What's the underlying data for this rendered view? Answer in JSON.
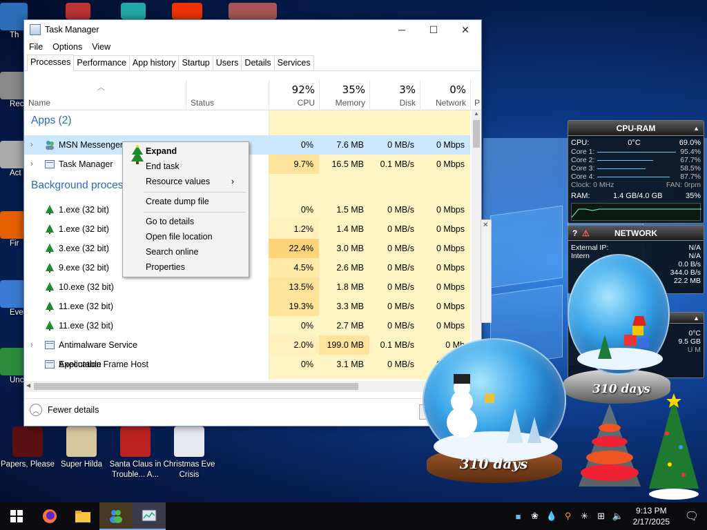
{
  "desktop_icons": [
    {
      "label": "Th",
      "color": "#2a6fb8"
    },
    {
      "label": "Recy",
      "color": "#888"
    },
    {
      "label": "Act",
      "color": "#aaa"
    },
    {
      "label": "Fir",
      "color": "#e66000"
    },
    {
      "label": "Ever",
      "color": "#3a7bd5"
    },
    {
      "label": "Unc",
      "color": "#2d8c3c"
    }
  ],
  "bottom_icons": [
    {
      "label": "Papers, Please",
      "color": "#5a1010"
    },
    {
      "label": "Super Hilda",
      "color": "#d8c8a0"
    },
    {
      "label": "Santa Claus in Trouble... A...",
      "color": "#b22"
    },
    {
      "label": "Christmas Eve Crisis",
      "color": "#e8e8f0"
    }
  ],
  "task_manager": {
    "title": "Task Manager",
    "menu": [
      "File",
      "Options",
      "View"
    ],
    "tabs": [
      "Processes",
      "Performance",
      "App history",
      "Startup",
      "Users",
      "Details",
      "Services"
    ],
    "active_tab": "Processes",
    "columns": {
      "name": "Name",
      "status": "Status",
      "cpu": {
        "pct": "92%",
        "label": "CPU"
      },
      "memory": {
        "pct": "35%",
        "label": "Memory"
      },
      "disk": {
        "pct": "3%",
        "label": "Disk"
      },
      "network": {
        "pct": "0%",
        "label": "Network"
      },
      "power": "P"
    },
    "groups": {
      "apps": "Apps (2)",
      "background": "Background proces"
    },
    "rows": [
      {
        "name": "MSN Messenger",
        "cpu": "0%",
        "mem": "7.6 MB",
        "disk": "0 MB/s",
        "net": "0 Mbps",
        "selected": true,
        "expander": true,
        "icon": "msn-icon"
      },
      {
        "name": "Task Manager",
        "cpu": "9.7%",
        "mem": "16.5 MB",
        "disk": "0.1 MB/s",
        "net": "0 Mbps",
        "expander": true,
        "icon": "taskmgr-icon"
      },
      {
        "name": "1.exe (32 bit)",
        "cpu": "0%",
        "mem": "1.5 MB",
        "disk": "0 MB/s",
        "net": "0 Mbps",
        "icon": "tree-icon"
      },
      {
        "name": "1.exe (32 bit)",
        "cpu": "1.2%",
        "mem": "1.4 MB",
        "disk": "0 MB/s",
        "net": "0 Mbps",
        "icon": "tree-icon"
      },
      {
        "name": "3.exe (32 bit)",
        "cpu": "22.4%",
        "mem": "3.0 MB",
        "disk": "0 MB/s",
        "net": "0 Mbps",
        "icon": "tree-icon"
      },
      {
        "name": "9.exe (32 bit)",
        "cpu": "4.5%",
        "mem": "2.6 MB",
        "disk": "0 MB/s",
        "net": "0 Mbps",
        "icon": "tree-icon"
      },
      {
        "name": "10.exe (32 bit)",
        "cpu": "13.5%",
        "mem": "1.8 MB",
        "disk": "0 MB/s",
        "net": "0 Mbps",
        "icon": "tree-icon"
      },
      {
        "name": "11.exe (32 bit)",
        "cpu": "19.3%",
        "mem": "3.3 MB",
        "disk": "0 MB/s",
        "net": "0 Mbps",
        "icon": "tree-icon"
      },
      {
        "name": "11.exe (32 bit)",
        "cpu": "0%",
        "mem": "2.7 MB",
        "disk": "0 MB/s",
        "net": "0 Mbps",
        "icon": "tree-icon"
      },
      {
        "name": "Antimalware Service Executable",
        "cpu": "2.0%",
        "mem": "199.0 MB",
        "disk": "0.1 MB/s",
        "net": "0 Mb",
        "expander": true,
        "icon": "service-icon"
      },
      {
        "name": "Application Frame Host",
        "cpu": "0%",
        "mem": "3.1 MB",
        "disk": "0 MB/s",
        "net": "0 Mbps",
        "icon": "service-icon"
      }
    ],
    "footer": {
      "fewer_details": "Fewer details"
    }
  },
  "context_menu": {
    "items": [
      "Expand",
      "End task",
      "Resource values",
      "Create dump file",
      "Go to details",
      "Open file location",
      "Search online",
      "Properties"
    ]
  },
  "cpu_ram_gadget": {
    "title": "CPU-RAM",
    "cpu_label": "CPU:",
    "cpu_temp": "0°C",
    "cpu_pct": "69.0%",
    "cores": [
      {
        "label": "Core 1:",
        "value": "95.4%"
      },
      {
        "label": "Core 2:",
        "value": "67.7%"
      },
      {
        "label": "Core 3:",
        "value": "58.5%"
      },
      {
        "label": "Core 4:",
        "value": "87.7%"
      }
    ],
    "clock": "Clock: 0 MHz",
    "fan": "FAN: 0rpm",
    "ram_label": "RAM:",
    "ram_value": "1.4 GB/4.0 GB",
    "ram_pct": "35%"
  },
  "network_gadget": {
    "title": "NETWORK",
    "help": "?",
    "warn": "⚠",
    "external_ip_label": "External IP:",
    "external_ip": "N/A",
    "internal_label": "Intern",
    "internal_value": "N/A",
    "rate1": "0.0 B/s",
    "rate2": "344.0 B/s",
    "rate3": "22.2 MB"
  },
  "globe_labels": {
    "small": "310 days",
    "large": "310 days"
  },
  "gadget3": {
    "temp": "0°C",
    "mem": "9.5 GB",
    "letters": "U M"
  },
  "taskbar": {
    "time": "9:13 PM",
    "date": "2/17/2025"
  }
}
